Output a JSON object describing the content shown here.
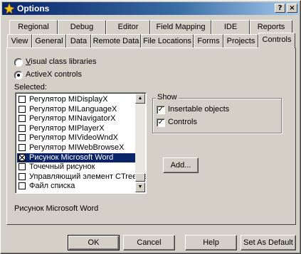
{
  "window": {
    "title": "Options"
  },
  "titlebar": {
    "help_glyph": "?",
    "close_glyph": "×"
  },
  "tabs_row1": [
    "Regional",
    "Debug",
    "Editor",
    "Field Mapping",
    "IDE",
    "Reports"
  ],
  "tabs_row2": [
    "View",
    "General",
    "Data",
    "Remote Data",
    "File Locations",
    "Forms",
    "Projects",
    "Controls"
  ],
  "active_tab": "Controls",
  "radios": {
    "visual": "Visual class libraries",
    "activex": "ActiveX controls",
    "selected_option": "activex"
  },
  "selected_label": "Selected:",
  "list_items": [
    {
      "text": "Регулятор MIDisplayX",
      "checked": false
    },
    {
      "text": "Регулятор MILanguageX",
      "checked": false
    },
    {
      "text": "Регулятор MINavigatorX",
      "checked": false
    },
    {
      "text": "Регулятор MIPlayerX",
      "checked": false
    },
    {
      "text": "Регулятор MIVideoWndX",
      "checked": false
    },
    {
      "text": "Регулятор MIWebBrowseX",
      "checked": false
    },
    {
      "text": "Рисунок Microsoft Word",
      "checked": true,
      "selected": true
    },
    {
      "text": "Точечный рисунок",
      "checked": false
    },
    {
      "text": "Управляющий элемент CTreeView",
      "checked": false
    },
    {
      "text": "Файл списка",
      "checked": false
    }
  ],
  "show_group": {
    "title": "Show",
    "insertable": "Insertable objects",
    "controls": "Controls",
    "insertable_checked": true,
    "controls_checked": true
  },
  "add_button": "Add...",
  "description": "Рисунок Microsoft Word",
  "buttons": {
    "ok": "OK",
    "cancel": "Cancel",
    "help": "Help",
    "set_default": "Set As Default"
  }
}
